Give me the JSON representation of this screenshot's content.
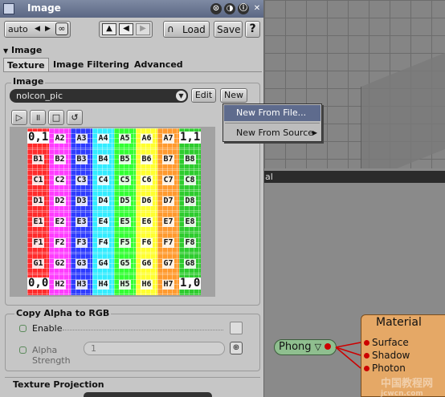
{
  "window": {
    "title": "Image",
    "buttons": [
      "⊙",
      "◑",
      "ⓘ",
      "✕"
    ]
  },
  "toolbar": {
    "mode_label": "auto",
    "prev_label": "◀",
    "next_label": "▶",
    "load_label": "Load",
    "save_label": "Save",
    "help_label": "?"
  },
  "section": {
    "title": "Image"
  },
  "tabs": [
    {
      "label": "Texture",
      "active": true
    },
    {
      "label": "Image Filtering",
      "active": false
    },
    {
      "label": "Advanced",
      "active": false
    }
  ],
  "image_group": {
    "label": "Image",
    "selected": "nolcon_pic",
    "edit_label": "Edit",
    "new_label": "New"
  },
  "context_menu": {
    "items": [
      {
        "label": "New From File...",
        "highlighted": true
      },
      {
        "label": "New From Source",
        "has_submenu": true,
        "submenu_glyph": "▶"
      }
    ]
  },
  "image_grid": {
    "columns": [
      "#ff2b2b",
      "#ff3cff",
      "#2e3cff",
      "#33ecff",
      "#33ff33",
      "#ffff2e",
      "#ff9a2e",
      "#2ecc2e"
    ],
    "rows": [
      [
        "0,1",
        "A2",
        "A3",
        "A4",
        "A5",
        "A6",
        "A7",
        "1,1"
      ],
      [
        "B1",
        "B2",
        "B3",
        "B4",
        "B5",
        "B6",
        "B7",
        "B8"
      ],
      [
        "C1",
        "C2",
        "C3",
        "C4",
        "C5",
        "C6",
        "C7",
        "C8"
      ],
      [
        "D1",
        "D2",
        "D3",
        "D4",
        "D5",
        "D6",
        "D7",
        "D8"
      ],
      [
        "E1",
        "E2",
        "E3",
        "E4",
        "E5",
        "E6",
        "E7",
        "E8"
      ],
      [
        "F1",
        "F2",
        "F3",
        "F4",
        "F5",
        "F6",
        "F7",
        "F8"
      ],
      [
        "G1",
        "G2",
        "G3",
        "G4",
        "G5",
        "G6",
        "G7",
        "G8"
      ],
      [
        "0,0",
        "H2",
        "H3",
        "H4",
        "H5",
        "H6",
        "H7",
        "1,0"
      ]
    ]
  },
  "copy_alpha": {
    "label": "Copy Alpha to RGB",
    "enable_label": "Enable",
    "alpha_strength_label_1": "Alpha",
    "alpha_strength_label_2": "Strength",
    "alpha_strength_value": "1"
  },
  "texture_projection": {
    "label": "Texture Projection"
  },
  "node_editor": {
    "title_fragment": "al",
    "phong_label": "Phong",
    "material_label": "Material",
    "ports": [
      "Surface",
      "Shadow",
      "Photon"
    ]
  },
  "watermark": {
    "text": "中国教程网",
    "url": "jcwcn.com"
  }
}
